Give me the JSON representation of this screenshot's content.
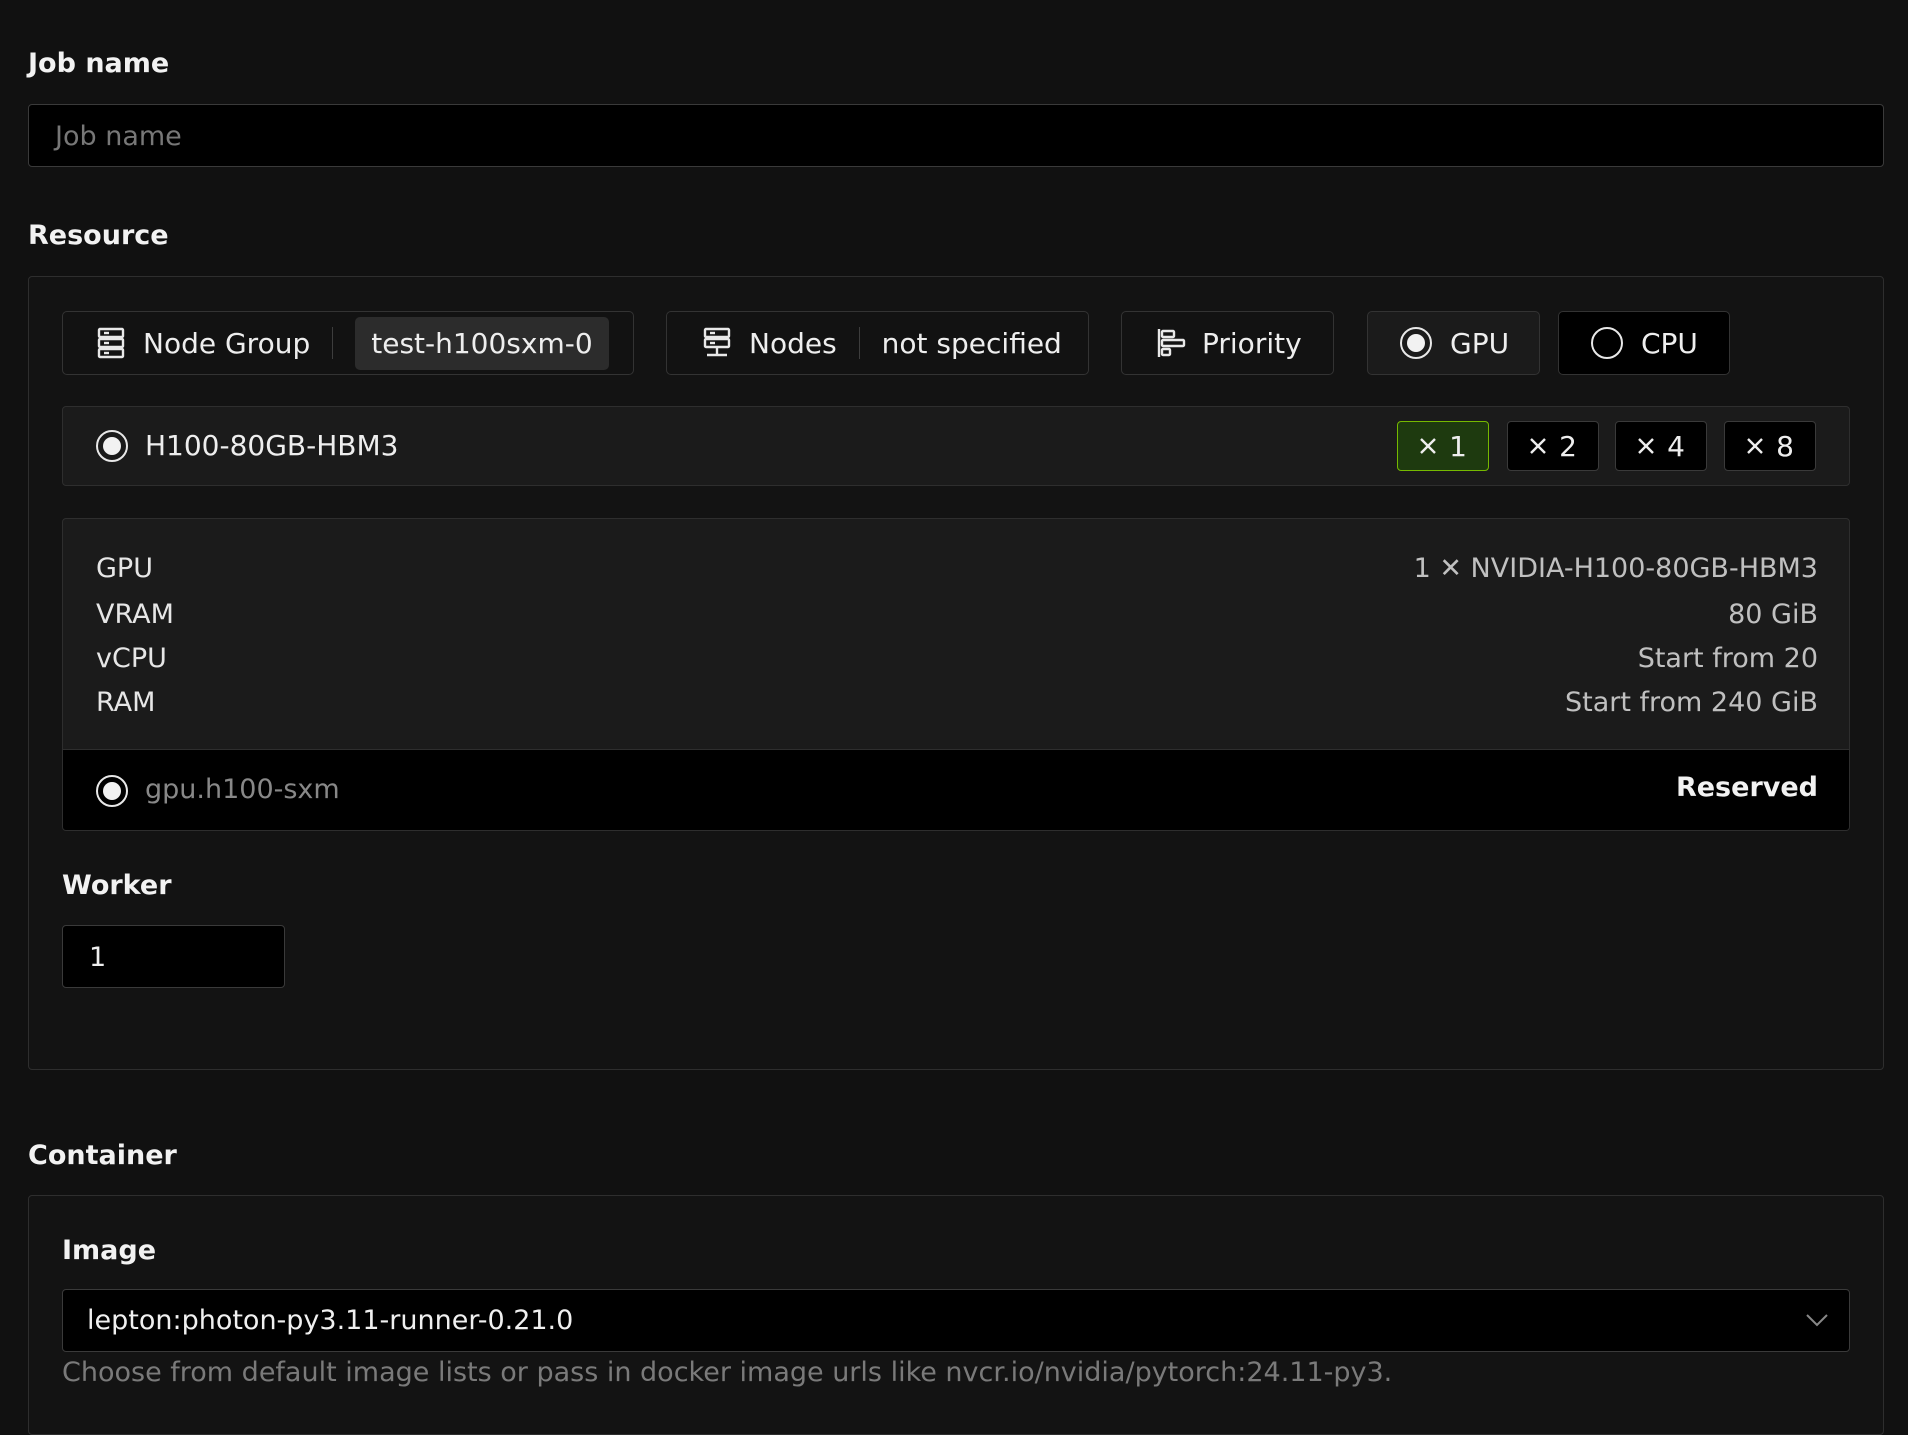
{
  "job": {
    "label": "Job name",
    "placeholder": "Job name",
    "value": ""
  },
  "resource": {
    "label": "Resource",
    "node_group": {
      "label": "Node Group",
      "value": "test-h100sxm-0",
      "icon": "server-stack-icon"
    },
    "nodes": {
      "label": "Nodes",
      "value": "not specified",
      "icon": "server-stack-icon"
    },
    "priority": {
      "label": "Priority",
      "icon": "priority-bars-icon"
    },
    "gpu_option": {
      "label": "GPU",
      "selected": true
    },
    "cpu_option": {
      "label": "CPU",
      "selected": false
    },
    "gpu_model": {
      "name": "H100-80GB-HBM3",
      "selected": true,
      "multipliers": [
        {
          "count": "1",
          "selected": true
        },
        {
          "count": "2",
          "selected": false
        },
        {
          "count": "4",
          "selected": false
        },
        {
          "count": "8",
          "selected": false
        }
      ]
    },
    "specs": [
      {
        "key": "GPU",
        "value": "1 ✕ NVIDIA-H100-80GB-HBM3"
      },
      {
        "key": "VRAM",
        "value": "80 GiB"
      },
      {
        "key": "vCPU",
        "value": "Start from 20"
      },
      {
        "key": "RAM",
        "value": "Start from 240 GiB"
      }
    ],
    "shape": {
      "name": "gpu.h100-sxm",
      "badge": "Reserved",
      "selected": true
    },
    "worker": {
      "label": "Worker",
      "value": "1"
    }
  },
  "container": {
    "label": "Container",
    "image": {
      "label": "Image",
      "value": "lepton:photon-py3.11-runner-0.21.0",
      "help": "Choose from default image lists or pass in docker image urls like nvcr.io/nvidia/pytorch:24.11-py3."
    }
  },
  "colors": {
    "accent": "#76b900",
    "background": "#111111"
  }
}
